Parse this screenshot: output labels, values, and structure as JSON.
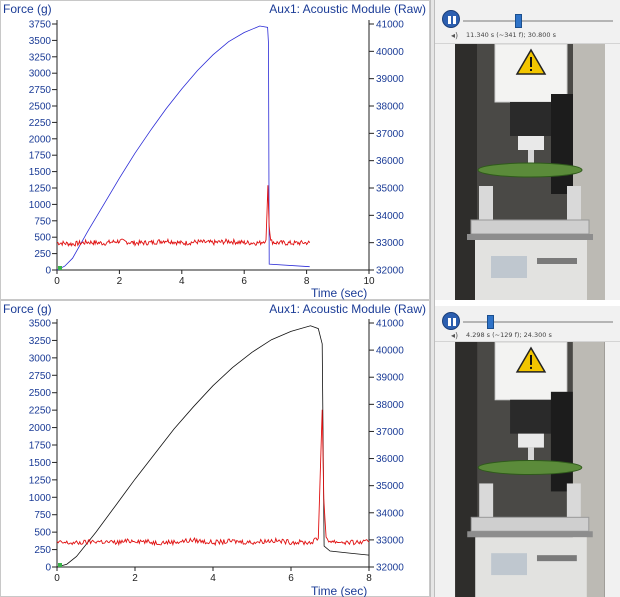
{
  "charts": [
    {
      "force_label": "Force (g)",
      "aux_label": "Aux1: Acoustic Module (Raw)",
      "time_label": "Time (sec)",
      "y_ticks": [
        "0",
        "250",
        "500",
        "750",
        "1000",
        "1250",
        "1500",
        "1750",
        "2000",
        "2250",
        "2500",
        "2750",
        "3000",
        "3250",
        "3500",
        "3750"
      ],
      "aux_ticks": [
        "32000",
        "33000",
        "34000",
        "35000",
        "36000",
        "37000",
        "38000",
        "39000",
        "40000",
        "41000"
      ],
      "x_ticks": [
        "0",
        "2",
        "4",
        "6",
        "8",
        "10"
      ]
    },
    {
      "force_label": "Force (g)",
      "aux_label": "Aux1: Acoustic Module (Raw)",
      "time_label": "Time (sec)",
      "y_ticks": [
        "0",
        "250",
        "500",
        "750",
        "1000",
        "1250",
        "1500",
        "1750",
        "2000",
        "2250",
        "2500",
        "2750",
        "3000",
        "3250",
        "3500"
      ],
      "aux_ticks": [
        "32000",
        "33000",
        "34000",
        "35000",
        "36000",
        "37000",
        "38000",
        "39000",
        "40000",
        "41000"
      ],
      "x_ticks": [
        "0",
        "2",
        "4",
        "6",
        "8"
      ]
    }
  ],
  "chart_data": [
    {
      "type": "line",
      "title": "",
      "xlabel": "Time (sec)",
      "ylabel": "Force (g)",
      "y2label": "Aux1: Acoustic Module (Raw)",
      "xlim": [
        0,
        10
      ],
      "ylim": [
        0,
        3750
      ],
      "y2lim": [
        32000,
        41000
      ],
      "grid": false,
      "series": [
        {
          "axis": "left",
          "color": "#2b2bd6",
          "x": [
            0.0,
            0.25,
            0.5,
            1.0,
            1.5,
            2.0,
            2.5,
            3.0,
            3.5,
            4.0,
            4.5,
            5.0,
            5.5,
            6.0,
            6.5,
            6.75,
            6.78,
            6.8,
            8.1
          ],
          "y": [
            0,
            60,
            180,
            600,
            1000,
            1400,
            1780,
            2130,
            2460,
            2760,
            3040,
            3280,
            3480,
            3620,
            3720,
            3700,
            3450,
            90,
            50
          ]
        },
        {
          "axis": "right",
          "color": "#e01010",
          "x": [
            0.0,
            0.5,
            1.0,
            1.5,
            2.0,
            2.5,
            3.0,
            3.5,
            4.0,
            4.5,
            5.0,
            5.5,
            6.0,
            6.5,
            6.7,
            6.76,
            6.8,
            6.85,
            7.0,
            7.5,
            8.0,
            8.1
          ],
          "y": [
            33000,
            32950,
            33020,
            32980,
            33060,
            32990,
            33000,
            33080,
            32980,
            33030,
            33000,
            33050,
            33000,
            32990,
            33100,
            35100,
            33600,
            33050,
            33000,
            32980,
            33000,
            33000
          ]
        }
      ]
    },
    {
      "type": "line",
      "title": "",
      "xlabel": "Time (sec)",
      "ylabel": "Force (g)",
      "y2label": "Aux1: Acoustic Module (Raw)",
      "xlim": [
        0,
        8
      ],
      "ylim": [
        0,
        3500
      ],
      "y2lim": [
        32000,
        41000
      ],
      "grid": false,
      "series": [
        {
          "axis": "left",
          "color": "#111111",
          "x": [
            0.0,
            0.25,
            0.5,
            1.0,
            1.5,
            2.0,
            2.5,
            3.0,
            3.5,
            4.0,
            4.5,
            5.0,
            5.5,
            6.0,
            6.5,
            6.7,
            6.8,
            6.85,
            7.0,
            7.5,
            8.0
          ],
          "y": [
            0,
            40,
            150,
            500,
            880,
            1260,
            1620,
            1980,
            2300,
            2600,
            2860,
            3080,
            3260,
            3380,
            3460,
            3420,
            3200,
            300,
            230,
            200,
            170
          ]
        },
        {
          "axis": "right",
          "color": "#e01010",
          "x": [
            0.0,
            0.5,
            1.0,
            1.5,
            2.0,
            2.5,
            3.0,
            3.5,
            4.0,
            4.5,
            5.0,
            5.5,
            6.0,
            6.5,
            6.7,
            6.8,
            6.84,
            6.9,
            7.0,
            7.5,
            8.0
          ],
          "y": [
            32900,
            32880,
            32950,
            32900,
            32980,
            32900,
            32920,
            32990,
            32900,
            32950,
            32910,
            32980,
            32920,
            32900,
            33050,
            37800,
            34500,
            33100,
            32950,
            32900,
            32920
          ]
        }
      ]
    }
  ],
  "players": [
    {
      "time_readout": "11.340 s (~341 f); 30.800 s",
      "progress": 0.368
    },
    {
      "time_readout": "4.298 s (~129 f); 24.300 s",
      "progress": 0.177
    }
  ],
  "colors": {
    "axis_text": "#1a3b96",
    "control_blue": "#2c5fb0",
    "warning_yellow": "#f2c500"
  }
}
